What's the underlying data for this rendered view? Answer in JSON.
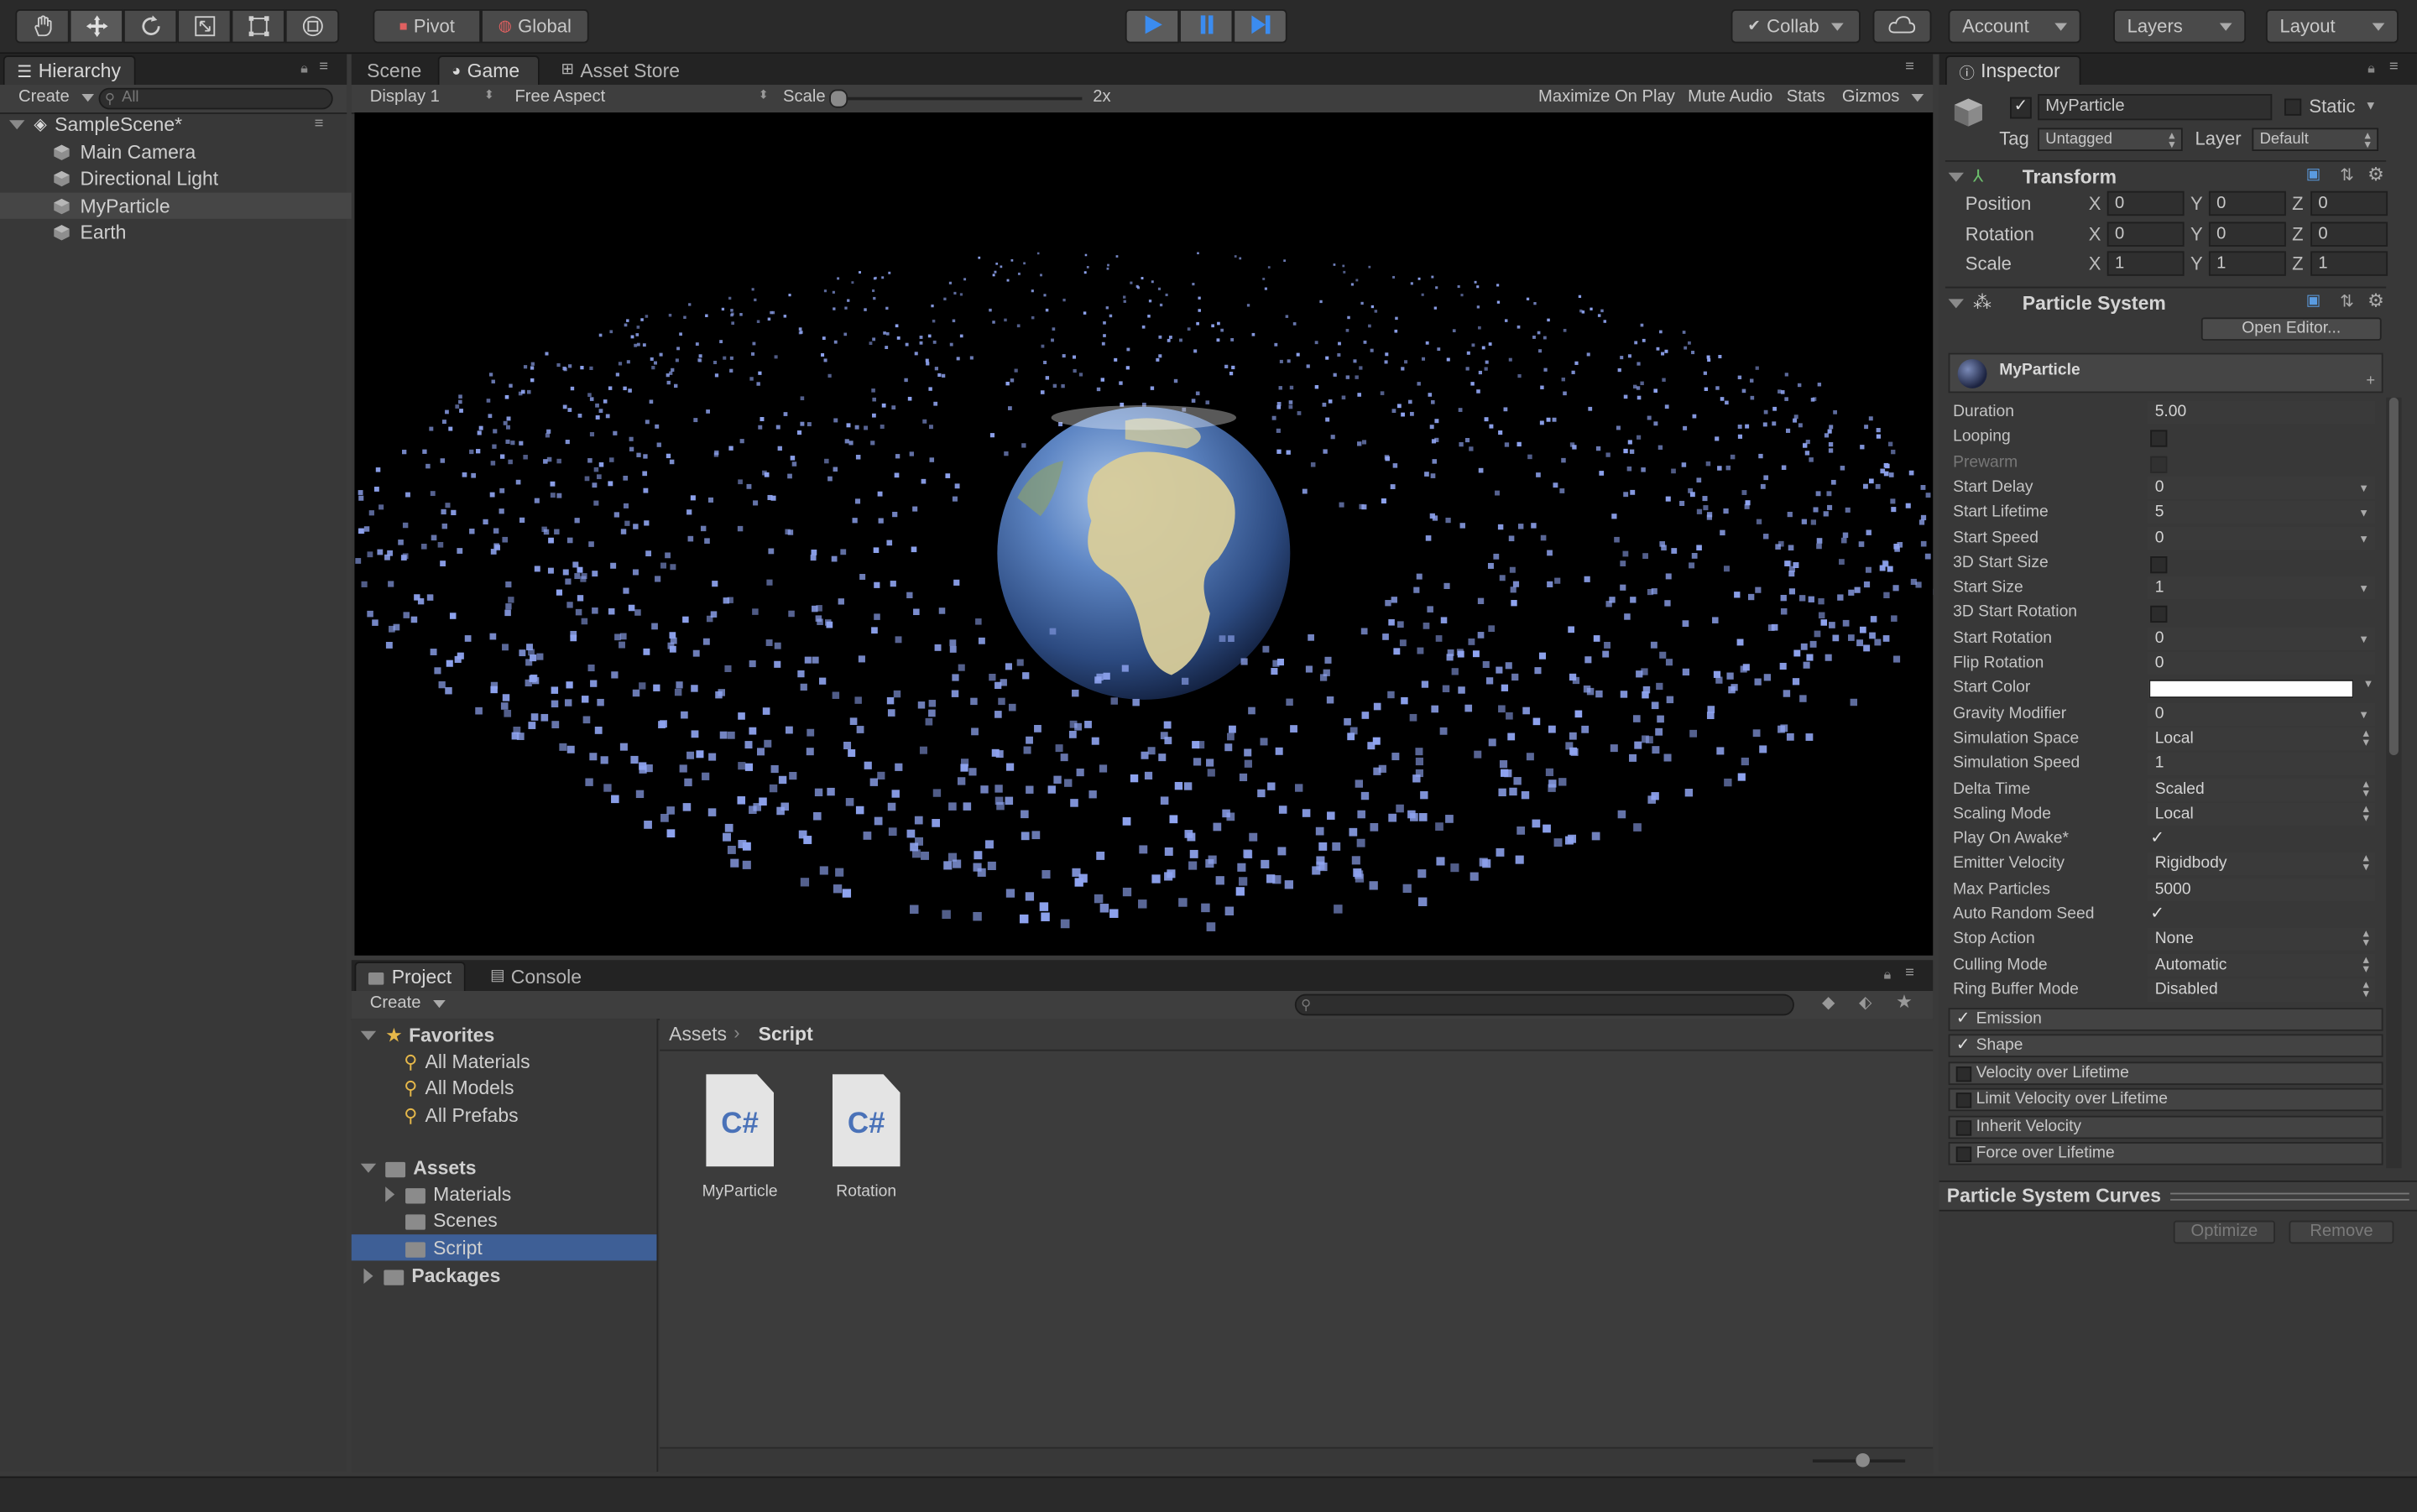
{
  "toolbar": {
    "pivot": "Pivot",
    "global": "Global",
    "collab": "Collab",
    "account": "Account",
    "layers": "Layers",
    "layout": "Layout"
  },
  "hierarchy": {
    "tab": "Hierarchy",
    "create": "Create",
    "search_placeholder": "All",
    "scene": "SampleScene*",
    "items": [
      "Main Camera",
      "Directional Light",
      "MyParticle",
      "Earth"
    ]
  },
  "scene_tabs": {
    "scene": "Scene",
    "game": "Game",
    "asset_store": "Asset Store"
  },
  "game_toolbar": {
    "display": "Display 1",
    "aspect": "Free Aspect",
    "scale_label": "Scale",
    "scale_value": "2x",
    "maximize": "Maximize On Play",
    "mute": "Mute Audio",
    "stats": "Stats",
    "gizmos": "Gizmos"
  },
  "project": {
    "tab": "Project",
    "console_tab": "Console",
    "create": "Create",
    "favorites": "Favorites",
    "favorite_items": [
      "All Materials",
      "All Models",
      "All Prefabs"
    ],
    "assets": "Assets",
    "asset_folders": [
      "Materials",
      "Scenes",
      "Script"
    ],
    "packages": "Packages",
    "breadcrumb": [
      "Assets",
      "Script"
    ],
    "files": [
      {
        "name": "MyParticle",
        "badge": "C#"
      },
      {
        "name": "Rotation",
        "badge": "C#"
      }
    ]
  },
  "inspector": {
    "tab": "Inspector",
    "object_name": "MyParticle",
    "static_label": "Static",
    "tag_label": "Tag",
    "tag_value": "Untagged",
    "layer_label": "Layer",
    "layer_value": "Default",
    "transform": {
      "title": "Transform",
      "rows": [
        {
          "label": "Position",
          "x": "0",
          "y": "0",
          "z": "0"
        },
        {
          "label": "Rotation",
          "x": "0",
          "y": "0",
          "z": "0"
        },
        {
          "label": "Scale",
          "x": "1",
          "y": "1",
          "z": "1"
        }
      ]
    },
    "particle_system": {
      "title": "Particle System",
      "open_editor": "Open Editor...",
      "header": "MyParticle",
      "properties": [
        {
          "label": "Duration",
          "kind": "value",
          "value": "5.00"
        },
        {
          "label": "Looping",
          "kind": "check",
          "checked": false
        },
        {
          "label": "Prewarm",
          "kind": "check",
          "checked": false,
          "disabled": true
        },
        {
          "label": "Start Delay",
          "kind": "curve",
          "value": "0"
        },
        {
          "label": "Start Lifetime",
          "kind": "curve",
          "value": "5"
        },
        {
          "label": "Start Speed",
          "kind": "curve",
          "value": "0"
        },
        {
          "label": "3D Start Size",
          "kind": "check",
          "checked": false
        },
        {
          "label": "Start Size",
          "kind": "curve",
          "value": "1"
        },
        {
          "label": "3D Start Rotation",
          "kind": "check",
          "checked": false
        },
        {
          "label": "Start Rotation",
          "kind": "curve",
          "value": "0"
        },
        {
          "label": "Flip Rotation",
          "kind": "value",
          "value": "0"
        },
        {
          "label": "Start Color",
          "kind": "color",
          "value": "#ffffff"
        },
        {
          "label": "Gravity Modifier",
          "kind": "curve",
          "value": "0"
        },
        {
          "label": "Simulation Space",
          "kind": "enum",
          "value": "Local"
        },
        {
          "label": "Simulation Speed",
          "kind": "value",
          "value": "1"
        },
        {
          "label": "Delta Time",
          "kind": "enum",
          "value": "Scaled"
        },
        {
          "label": "Scaling Mode",
          "kind": "enum",
          "value": "Local"
        },
        {
          "label": "Play On Awake*",
          "kind": "check",
          "checked": true
        },
        {
          "label": "Emitter Velocity",
          "kind": "enum",
          "value": "Rigidbody"
        },
        {
          "label": "Max Particles",
          "kind": "value",
          "value": "5000"
        },
        {
          "label": "Auto Random Seed",
          "kind": "check",
          "checked": true
        },
        {
          "label": "Stop Action",
          "kind": "enum",
          "value": "None"
        },
        {
          "label": "Culling Mode",
          "kind": "enum",
          "value": "Automatic"
        },
        {
          "label": "Ring Buffer Mode",
          "kind": "enum",
          "value": "Disabled"
        }
      ],
      "modules": [
        {
          "label": "Emission",
          "checked": true
        },
        {
          "label": "Shape",
          "checked": true
        },
        {
          "label": "Velocity over Lifetime",
          "checked": false
        },
        {
          "label": "Limit Velocity over Lifetime",
          "checked": false
        },
        {
          "label": "Inherit Velocity",
          "checked": false
        },
        {
          "label": "Force over Lifetime",
          "checked": false
        }
      ]
    },
    "curves_title": "Particle System Curves",
    "optimize": "Optimize",
    "remove": "Remove"
  },
  "colors": {
    "play_accent": "#3b8cf0",
    "selection": "#3e5f96",
    "particle": "#8fa4f0"
  }
}
